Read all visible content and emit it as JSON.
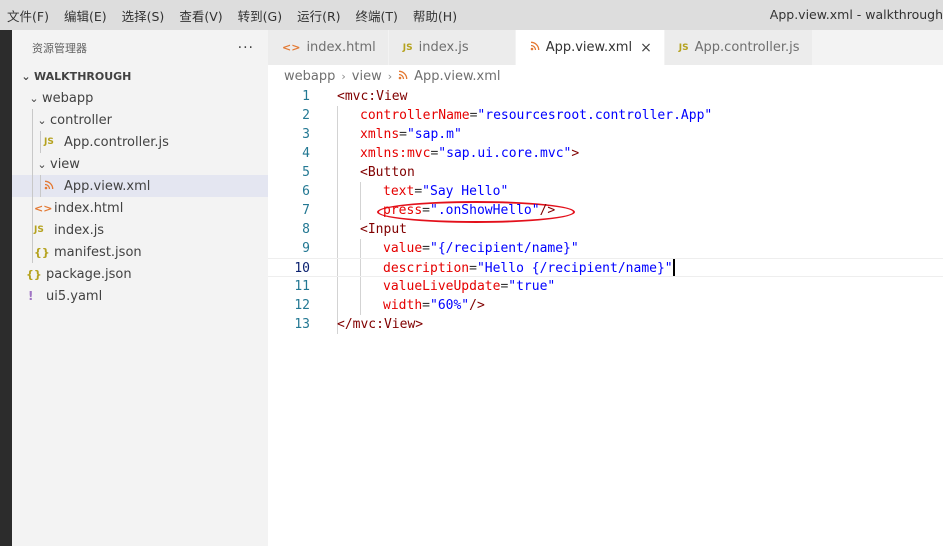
{
  "menu": {
    "items": [
      "文件(F)",
      "编辑(E)",
      "选择(S)",
      "查看(V)",
      "转到(G)",
      "运行(R)",
      "终端(T)",
      "帮助(H)"
    ],
    "window_title": "App.view.xml - walkthrough"
  },
  "sidebar": {
    "title": "资源管理器",
    "more": "···",
    "section": "WALKTHROUGH",
    "tree": {
      "webapp": "webapp",
      "controller": "controller",
      "app_controller": "App.controller.js",
      "view": "view",
      "app_view": "App.view.xml",
      "index_html": "index.html",
      "index_js": "index.js",
      "manifest": "manifest.json",
      "package": "package.json",
      "ui5yaml": "ui5.yaml"
    },
    "icons": {
      "js": "JS",
      "html": "<>",
      "xml": "rss-icon",
      "json": "{}",
      "yaml": "!"
    }
  },
  "tabs": [
    {
      "label": "index.html",
      "icon": "<>",
      "active": false
    },
    {
      "label": "index.js",
      "icon": "JS",
      "active": false
    },
    {
      "label": "App.view.xml",
      "icon": "rss-icon",
      "active": true,
      "close": "×"
    },
    {
      "label": "App.controller.js",
      "icon": "JS",
      "active": false
    }
  ],
  "breadcrumb": {
    "parts": [
      "webapp",
      "view",
      "App.view.xml"
    ]
  },
  "editor": {
    "line_numbers": [
      "1",
      "2",
      "3",
      "4",
      "5",
      "6",
      "7",
      "8",
      "9",
      "10",
      "11",
      "12",
      "13"
    ],
    "current_line": "10",
    "lines": [
      [
        [
          "tag",
          "<mvc:View"
        ]
      ],
      [
        [
          "attr",
          "controllerName"
        ],
        [
          "punct",
          "="
        ],
        [
          "str",
          "\"resourcesroot.controller.App\""
        ]
      ],
      [
        [
          "attr",
          "xmlns"
        ],
        [
          "punct",
          "="
        ],
        [
          "str",
          "\"sap.m\""
        ]
      ],
      [
        [
          "attr",
          "xmlns:mvc"
        ],
        [
          "punct",
          "="
        ],
        [
          "str",
          "\"sap.ui.core.mvc\""
        ],
        [
          "tag",
          ">"
        ]
      ],
      [
        [
          "tag",
          "<Button"
        ]
      ],
      [
        [
          "attr",
          "text"
        ],
        [
          "punct",
          "="
        ],
        [
          "str",
          "\"Say Hello\""
        ]
      ],
      [
        [
          "attr",
          "press"
        ],
        [
          "punct",
          "="
        ],
        [
          "str",
          "\".onShowHello\""
        ],
        [
          "tag",
          "/>"
        ]
      ],
      [
        [
          "tag",
          "<Input"
        ]
      ],
      [
        [
          "attr",
          "value"
        ],
        [
          "punct",
          "="
        ],
        [
          "str",
          "\"{/recipient/name}\""
        ]
      ],
      [
        [
          "attr",
          "description"
        ],
        [
          "punct",
          "="
        ],
        [
          "str",
          "\"Hello {/recipient/name}\""
        ]
      ],
      [
        [
          "attr",
          "valueLiveUpdate"
        ],
        [
          "punct",
          "="
        ],
        [
          "str",
          "\"true\""
        ]
      ],
      [
        [
          "attr",
          "width"
        ],
        [
          "punct",
          "="
        ],
        [
          "str",
          "\"60%\""
        ],
        [
          "tag",
          "/>"
        ]
      ],
      [
        [
          "tag",
          "</mvc:View>"
        ]
      ]
    ]
  },
  "colors": {
    "annotation_ellipse": "#e3101b",
    "tag": "#800000",
    "attribute": "#e50000",
    "string": "#0000ff",
    "line_number": "#237893"
  }
}
